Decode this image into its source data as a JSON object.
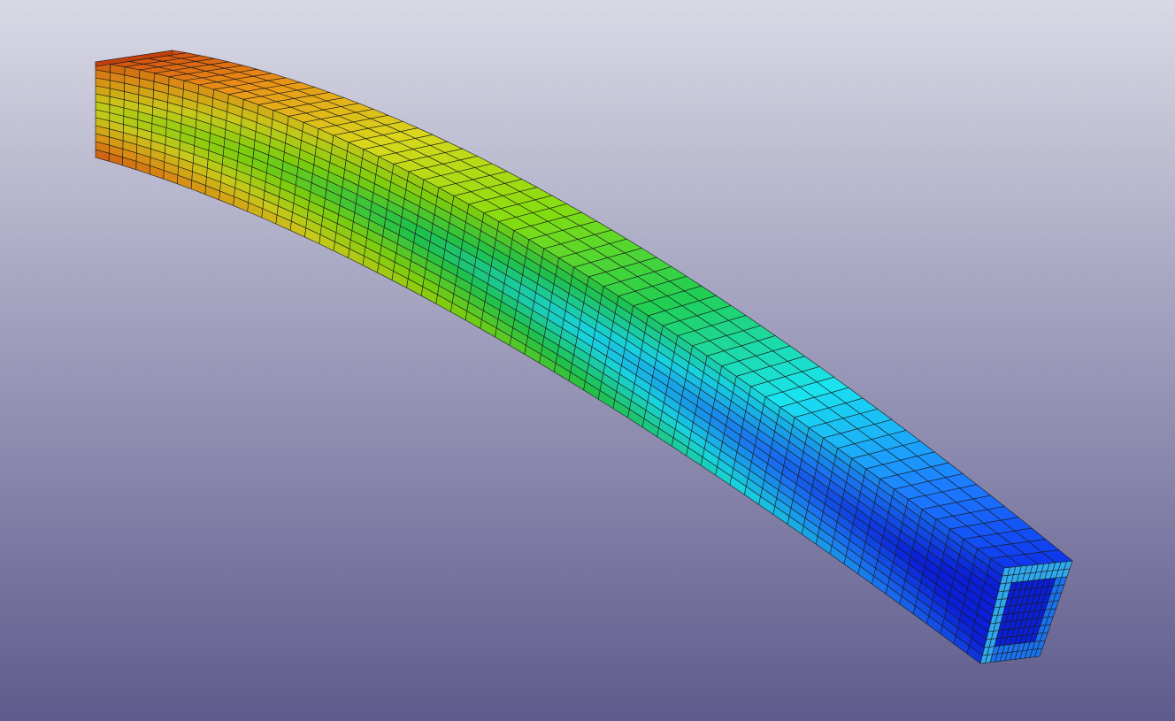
{
  "viewport": {
    "background_top": "#d9d9e5",
    "background_mid": "#a4a3c0",
    "background_bottom": "#5e5b8c"
  },
  "model": {
    "type": "meshed-hollow-square-beam",
    "render_mode": "surface-with-edges",
    "color_map": [
      "#0a1fd6",
      "#1a73ee",
      "#18d2de",
      "#1fc04a",
      "#7ccd0e",
      "#c8c81a",
      "#d98a14",
      "#c2400e"
    ],
    "mesh_edge_color": "#1a1a1a",
    "mesh_segments_along_length": 62,
    "mesh_segments_across_face": 8,
    "cross_section_shape": "hollow-square"
  }
}
